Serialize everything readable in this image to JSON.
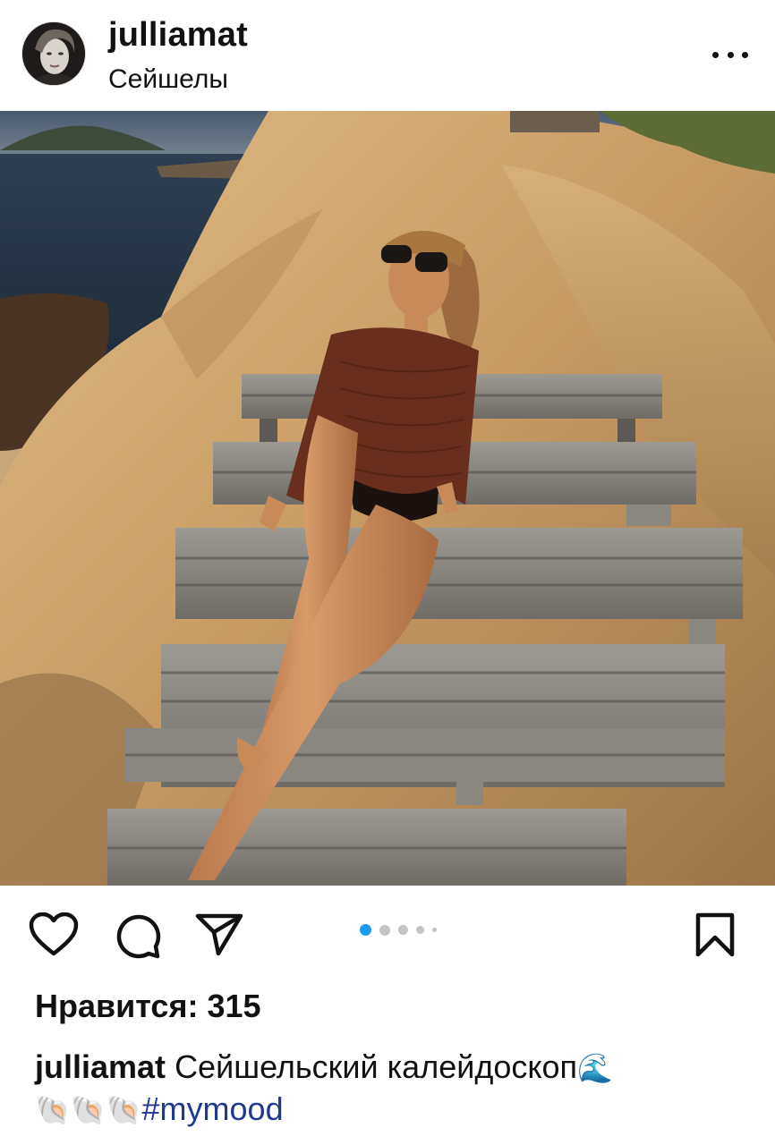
{
  "post": {
    "username": "julliamat",
    "location": "Сейшелы",
    "likes_text": "Нравится: 315",
    "caption": {
      "username": "julliamat",
      "text": "Сейшельский калейдоскоп",
      "wave_emoji": "🌊",
      "shell_emojis": "🐚🐚🐚",
      "hashtag": "#mymood"
    }
  },
  "carousel": {
    "count": 5,
    "active_index": 0,
    "active_color": "#1d9bf0",
    "inactive_color": "#c4c4c4"
  },
  "icons": {
    "more": "more-horizontal-icon",
    "like": "heart-icon",
    "comment": "comment-icon",
    "share": "send-icon",
    "save": "bookmark-icon"
  },
  "colors": {
    "hashtag": "#1f3a8f",
    "text": "#111111"
  }
}
